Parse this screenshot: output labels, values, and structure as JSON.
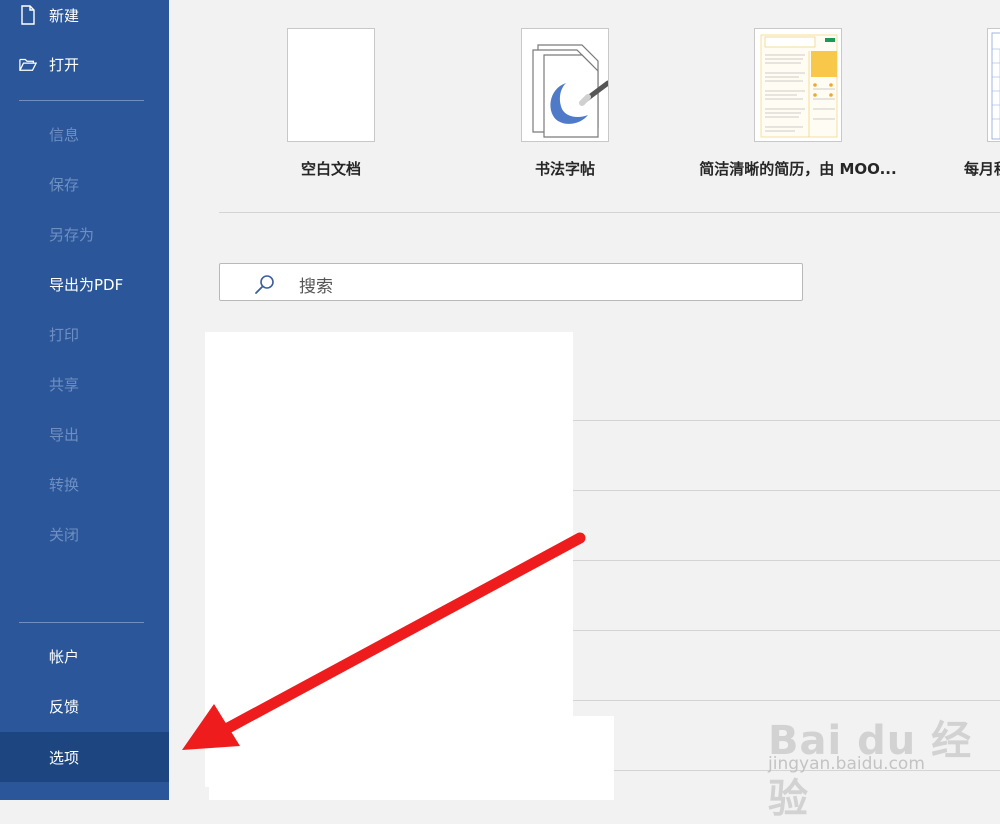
{
  "sidebar": {
    "items": [
      {
        "id": "new",
        "label": "新建",
        "icon": "new-document-icon",
        "enabled": true
      },
      {
        "id": "open",
        "label": "打开",
        "icon": "open-folder-icon",
        "enabled": true
      },
      {
        "id": "info",
        "label": "信息",
        "enabled": false
      },
      {
        "id": "save",
        "label": "保存",
        "enabled": false
      },
      {
        "id": "save-as",
        "label": "另存为",
        "enabled": false
      },
      {
        "id": "export-pdf",
        "label": "导出为PDF",
        "enabled": true
      },
      {
        "id": "print",
        "label": "打印",
        "enabled": false
      },
      {
        "id": "share",
        "label": "共享",
        "enabled": false
      },
      {
        "id": "export",
        "label": "导出",
        "enabled": false
      },
      {
        "id": "convert",
        "label": "转换",
        "enabled": false
      },
      {
        "id": "close",
        "label": "关闭",
        "enabled": false
      }
    ],
    "bottom_items": [
      {
        "id": "account",
        "label": "帐户"
      },
      {
        "id": "feedback",
        "label": "反馈"
      },
      {
        "id": "options",
        "label": "选项",
        "selected": true
      }
    ],
    "colors": {
      "background": "#2b579a",
      "selected": "#1d4680",
      "disabled_text": "#6f8fc2"
    }
  },
  "templates": [
    {
      "label": "空白文档"
    },
    {
      "label": "书法字帖"
    },
    {
      "label": "简洁清晰的简历，由 MOO..."
    },
    {
      "label": "每月程"
    }
  ],
  "search": {
    "placeholder": "搜索",
    "icon": "search-icon"
  },
  "annotation": {
    "color": "#ee1c1c",
    "kind": "red-arrow"
  },
  "watermark": {
    "brand": "Bai du 经验",
    "url": "jingyan.baidu.com"
  }
}
